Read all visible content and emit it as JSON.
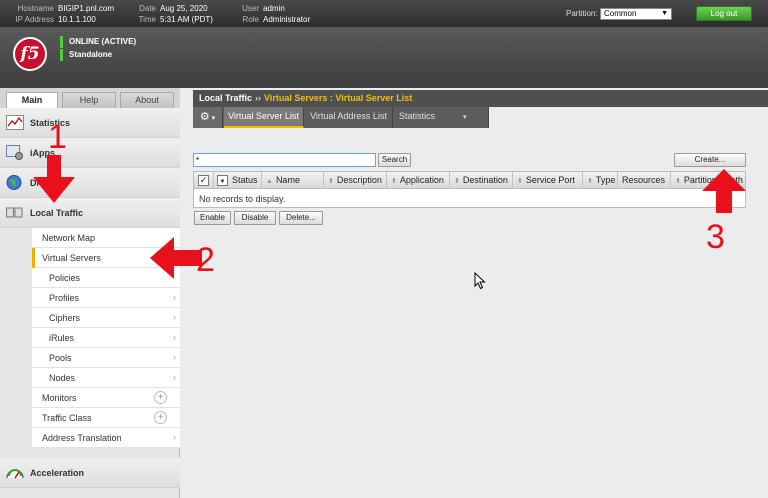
{
  "header": {
    "hostname_label": "Hostname",
    "hostname": "BIGIP1.pnl.com",
    "ip_label": "IP Address",
    "ip": "10.1.1.100",
    "date_label": "Date",
    "date": "Aug 25, 2020",
    "time_label": "Time",
    "time": "5:31 AM (PDT)",
    "user_label": "User",
    "user": "admin",
    "role_label": "Role",
    "role": "Administrator",
    "partition_label": "Partition:",
    "partition_value": "Common",
    "logout_label": "Log out"
  },
  "status": {
    "logo": "f5",
    "line1": "ONLINE (ACTIVE)",
    "line2": "Standalone"
  },
  "nav_tabs": [
    {
      "label": "Main",
      "active": true
    },
    {
      "label": "Help",
      "active": false
    },
    {
      "label": "About",
      "active": false
    }
  ],
  "sidebar": {
    "categories": [
      {
        "label": "Statistics",
        "icon": "statistics-icon"
      },
      {
        "label": "iApps",
        "icon": "iapps-icon"
      },
      {
        "label": "DNS",
        "icon": "dns-globe-icon"
      },
      {
        "label": "Local Traffic",
        "icon": "local-traffic-icon"
      },
      {
        "label": "Acceleration",
        "icon": "acceleration-gauge-icon"
      }
    ],
    "local_traffic_items": [
      {
        "label": "Network Map"
      },
      {
        "label": "Virtual Servers"
      },
      {
        "label": "Policies"
      },
      {
        "label": "Profiles"
      },
      {
        "label": "Ciphers"
      },
      {
        "label": "iRules"
      },
      {
        "label": "Pools"
      },
      {
        "label": "Nodes"
      },
      {
        "label": "Monitors"
      },
      {
        "label": "Traffic Class"
      },
      {
        "label": "Address Translation"
      }
    ]
  },
  "breadcrumb": {
    "section": "Local Traffic",
    "separator": "››",
    "path": "Virtual Servers : Virtual Server List"
  },
  "subtabs": [
    {
      "label": "Virtual Server List",
      "active": true
    },
    {
      "label": "Virtual Address List",
      "active": false
    },
    {
      "label": "Statistics",
      "active": false
    }
  ],
  "list": {
    "search_value": "*",
    "search_button": "Search",
    "create_button": "Create...",
    "columns": [
      "Status",
      "Name",
      "Description",
      "Application",
      "Destination",
      "Service Port",
      "Type",
      "Resources",
      "Partition / Path"
    ],
    "empty_message": "No records to display.",
    "enable_button": "Enable",
    "disable_button": "Disable",
    "delete_button": "Delete..."
  },
  "annotations": {
    "step1": "1",
    "step2": "2",
    "step3": "3",
    "color": "#e8101a"
  }
}
